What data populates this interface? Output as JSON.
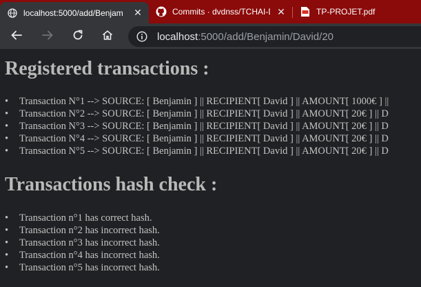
{
  "browser": {
    "tabs": [
      {
        "title": "localhost:5000/add/Benjam",
        "icon": "globe-icon",
        "active": true
      },
      {
        "title": "Commits · dvdnss/TCHAI-D",
        "icon": "github-icon",
        "active": false
      },
      {
        "title": "TP-PROJET.pdf",
        "icon": "pdf-icon",
        "active": false
      }
    ],
    "url_host": "localhost",
    "url_rest": ":5000/add/Benjamin/David/20"
  },
  "page": {
    "transactions_heading": "Registered transactions :",
    "transactions": [
      "Transaction N°1 --> SOURCE: [ Benjamin ] || RECIPIENT[ David ] || AMOUNT[ 1000€ ] ||",
      "Transaction N°2 --> SOURCE: [ Benjamin ] || RECIPIENT[ David ] || AMOUNT[ 20€ ] || D",
      "Transaction N°3 --> SOURCE: [ Benjamin ] || RECIPIENT[ David ] || AMOUNT[ 20€ ] || D",
      "Transaction N°4 --> SOURCE: [ Benjamin ] || RECIPIENT[ David ] || AMOUNT[ 20€ ] || D",
      "Transaction N°5 --> SOURCE: [ Benjamin ] || RECIPIENT[ David ] || AMOUNT[ 20€ ] || D"
    ],
    "hash_heading": "Transactions hash check :",
    "hash_results": [
      "Transaction n°1 has correct hash.",
      "Transaction n°2 has incorrect hash.",
      "Transaction n°3 has incorrect hash.",
      "Transaction n°4 has incorrect hash.",
      "Transaction n°5 has incorrect hash."
    ]
  },
  "colors": {
    "tab_strip": "#8b0a0a",
    "toolbar": "#35363a",
    "page_background": "#202124",
    "page_text": "#c4c4c4"
  }
}
